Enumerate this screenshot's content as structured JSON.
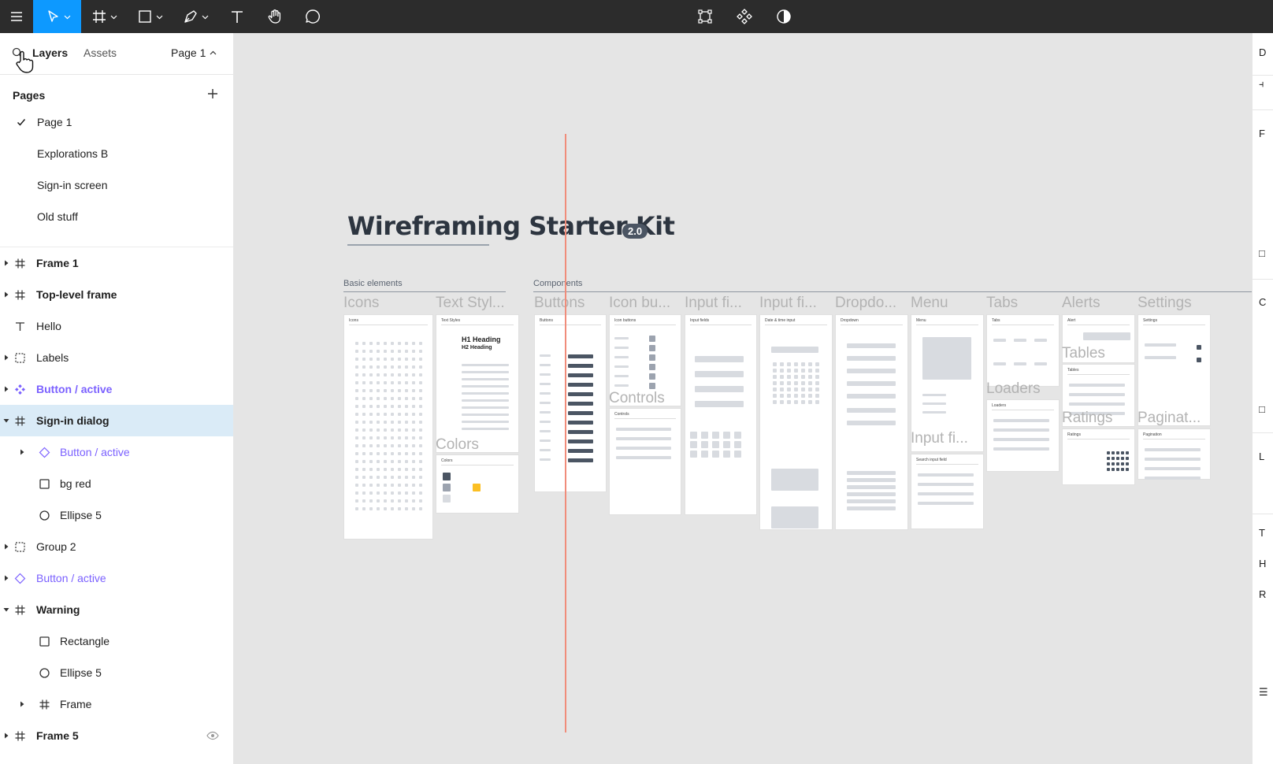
{
  "toolbar": {
    "tools": [
      "menu-icon",
      "move-tool-icon",
      "frame-tool-icon",
      "shape-tool-icon",
      "pen-tool-icon",
      "text-tool-icon",
      "hand-tool-icon",
      "comment-tool-icon"
    ],
    "center_tools": [
      "edit-object-icon",
      "components-icon",
      "contrast-icon"
    ],
    "active_color": "#0d99ff"
  },
  "left_panel": {
    "tab_layers": "Layers",
    "tab_assets": "Assets",
    "page_selector": "Page 1",
    "pages_heading": "Pages",
    "pages": [
      {
        "name": "Page 1",
        "current": true
      },
      {
        "name": "Explorations B",
        "current": false
      },
      {
        "name": "Sign-in screen",
        "current": false
      },
      {
        "name": "Old stuff",
        "current": false
      }
    ],
    "layers": [
      {
        "name": "Frame 1",
        "icon": "frame-icon",
        "level": 0,
        "arrow": "right",
        "bold": true
      },
      {
        "name": "Top-level frame",
        "icon": "frame-icon",
        "level": 0,
        "arrow": "right",
        "bold": true
      },
      {
        "name": "Hello",
        "icon": "text-icon",
        "level": 0,
        "arrow": "",
        "bold": false
      },
      {
        "name": "Labels",
        "icon": "section-icon",
        "level": 0,
        "arrow": "right",
        "bold": false
      },
      {
        "name": "Button / active",
        "icon": "component-icon",
        "level": 0,
        "arrow": "right",
        "bold": true,
        "purple": true
      },
      {
        "name": "Sign-in dialog",
        "icon": "frame-icon",
        "level": 0,
        "arrow": "down",
        "bold": true,
        "selected": true
      },
      {
        "name": "Button / active",
        "icon": "instance-icon",
        "level": 1,
        "arrow": "right",
        "bold": false,
        "purple": true
      },
      {
        "name": "bg red",
        "icon": "rectangle-icon",
        "level": 1,
        "arrow": "",
        "bold": false
      },
      {
        "name": "Ellipse 5",
        "icon": "ellipse-icon",
        "level": 1,
        "arrow": "",
        "bold": false
      },
      {
        "name": "Group 2",
        "icon": "section-icon",
        "level": 0,
        "arrow": "right",
        "bold": false
      },
      {
        "name": "Button / active",
        "icon": "instance-icon",
        "level": 0,
        "arrow": "right",
        "bold": false,
        "purple": true
      },
      {
        "name": "Warning",
        "icon": "frame-icon",
        "level": 0,
        "arrow": "down",
        "bold": true
      },
      {
        "name": "Rectangle",
        "icon": "rectangle-icon",
        "level": 1,
        "arrow": "",
        "bold": false
      },
      {
        "name": "Ellipse 5",
        "icon": "ellipse-icon",
        "level": 1,
        "arrow": "",
        "bold": false
      },
      {
        "name": "Frame",
        "icon": "frame-icon",
        "level": 1,
        "arrow": "right",
        "bold": false
      },
      {
        "name": "Frame 5",
        "icon": "frame-icon",
        "level": 0,
        "arrow": "right",
        "bold": true,
        "eye": true
      }
    ]
  },
  "canvas": {
    "title": "Wireframing Starter Kit",
    "badge": "2.0",
    "sections": [
      {
        "label": "Basic elements"
      },
      {
        "label": "Components"
      }
    ],
    "boards": [
      {
        "title": "Icons",
        "inner": "Icons"
      },
      {
        "title": "Text Styl...",
        "inner": "Text Styles"
      },
      {
        "title": "Buttons",
        "inner": "Buttons"
      },
      {
        "title": "Icon bu...",
        "inner": "Icon buttons"
      },
      {
        "title": "Input fi...",
        "inner": "Input fields"
      },
      {
        "title": "Input fi...",
        "inner": "Date & time input"
      },
      {
        "title": "Dropdo...",
        "inner": "Dropdown"
      },
      {
        "title": "Menu",
        "inner": "Menu"
      },
      {
        "title": "Tabs",
        "inner": "Tabs"
      },
      {
        "title": "Alerts",
        "inner": "Alert"
      },
      {
        "title": "Settings",
        "inner": "Settings"
      }
    ],
    "overlay_labels": [
      "Colors",
      "Controls",
      "Tables",
      "Loaders",
      "Ratings",
      "Paginat...",
      "Input fi..."
    ],
    "text_styles": {
      "h1": "H1 Heading",
      "h2": "H2 Heading"
    },
    "sub_boards": {
      "colors": "Colors",
      "controls": "Controls",
      "search_input": "Search input field",
      "tables": "Tables",
      "loaders": "Loaders",
      "ratings": "Ratings",
      "pagination": "Pagination"
    },
    "guide_color": "#f08c7a"
  },
  "right_panel": {
    "fragments": [
      "D",
      "F",
      "C",
      "L",
      "T",
      "H",
      "R"
    ]
  }
}
